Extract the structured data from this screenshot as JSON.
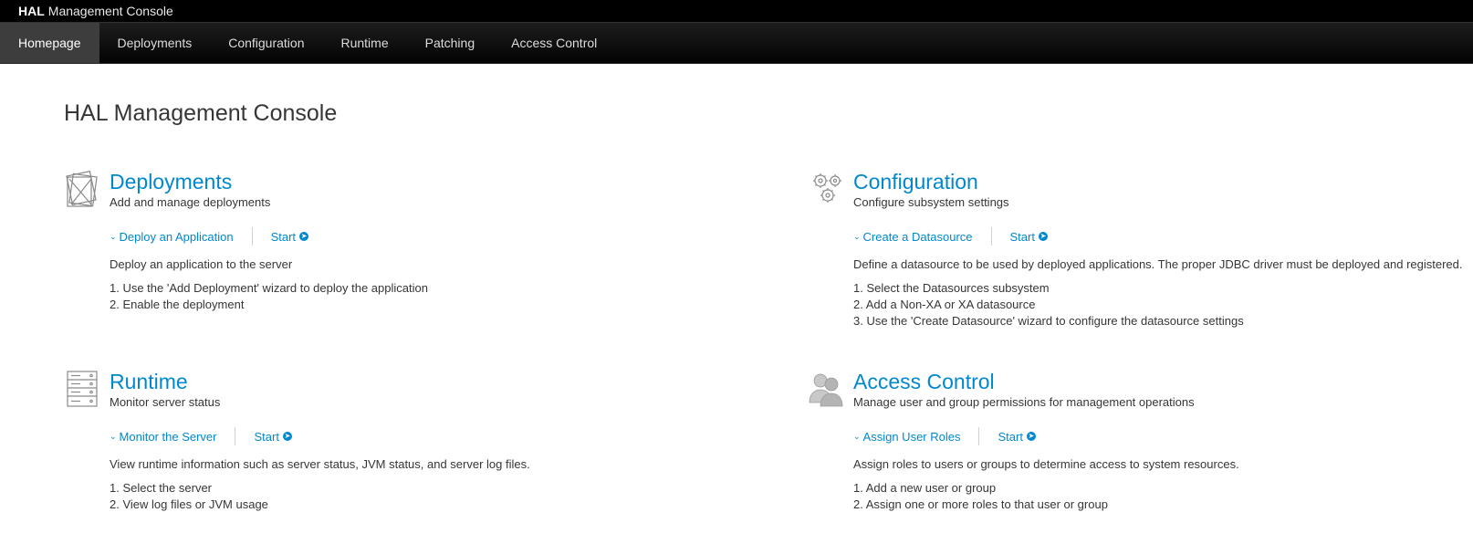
{
  "app": {
    "brand_strong": "HAL",
    "brand_rest": "Management Console"
  },
  "nav": {
    "items": [
      "Homepage",
      "Deployments",
      "Configuration",
      "Runtime",
      "Patching",
      "Access Control"
    ],
    "active": "Homepage"
  },
  "page": {
    "title": "HAL Management Console"
  },
  "cards": {
    "deployments": {
      "icon": "deployments-icon",
      "title": "Deployments",
      "subtitle": "Add and manage deployments",
      "action": "Deploy an Application",
      "start": "Start",
      "description": "Deploy an application to the server",
      "steps": [
        "1. Use the 'Add Deployment' wizard to deploy the application",
        "2. Enable the deployment"
      ]
    },
    "configuration": {
      "icon": "gears-icon",
      "title": "Configuration",
      "subtitle": "Configure subsystem settings",
      "action": "Create a Datasource",
      "start": "Start",
      "description": "Define a datasource to be used by deployed applications. The proper JDBC driver must be deployed and registered.",
      "steps": [
        "1. Select the Datasources subsystem",
        "2. Add a Non-XA or XA datasource",
        "3. Use the 'Create Datasource' wizard to configure the datasource settings"
      ]
    },
    "runtime": {
      "icon": "server-icon",
      "title": "Runtime",
      "subtitle": "Monitor server status",
      "action": "Monitor the Server",
      "start": "Start",
      "description": "View runtime information such as server status, JVM status, and server log files.",
      "steps": [
        "1. Select the server",
        "2. View log files or JVM usage"
      ]
    },
    "access_control": {
      "icon": "users-icon",
      "title": "Access Control",
      "subtitle": "Manage user and group permissions for management operations",
      "action": "Assign User Roles",
      "start": "Start",
      "description": "Assign roles to users or groups to determine access to system resources.",
      "steps": [
        "1. Add a new user or group",
        "2. Assign one or more roles to that user or group"
      ]
    }
  },
  "colors": {
    "link": "#0088ce",
    "nav_bg": "#030303",
    "nav_active": "#3d3d3d"
  }
}
